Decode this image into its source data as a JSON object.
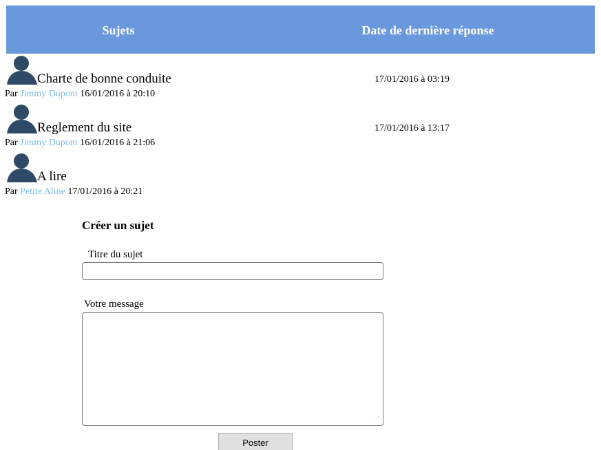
{
  "header": {
    "subjects_label": "Sujets",
    "last_reply_label": "Date de dernière réponse",
    "background_color": "#6a98dd"
  },
  "topics": [
    {
      "icon": "user-silhouette-icon",
      "title": "Charte de bonne conduite",
      "by_prefix": "Par",
      "author": "Jimmy Dupont",
      "created": "16/01/2016 à 20:10",
      "last_reply": "17/01/2016 à 03:19"
    },
    {
      "icon": "user-silhouette-icon",
      "title": "Reglement du site",
      "by_prefix": "Par",
      "author": "Jimmy Dupont",
      "created": "16/01/2016 à 21:06",
      "last_reply": "17/01/2016 à 13:17"
    },
    {
      "icon": "user-silhouette-icon",
      "title": "A lire",
      "by_prefix": "Par",
      "author": "Petite Aline",
      "created": "17/01/2016 à 20:21",
      "last_reply": ""
    }
  ],
  "form": {
    "title": "Créer un sujet",
    "subject_title_label": "Titre du sujet",
    "subject_title_value": "",
    "message_label": "Votre message",
    "message_value": "",
    "submit_label": "Poster"
  },
  "colors": {
    "author_link": "#7cc0e8",
    "avatar": "#2f4a66"
  }
}
